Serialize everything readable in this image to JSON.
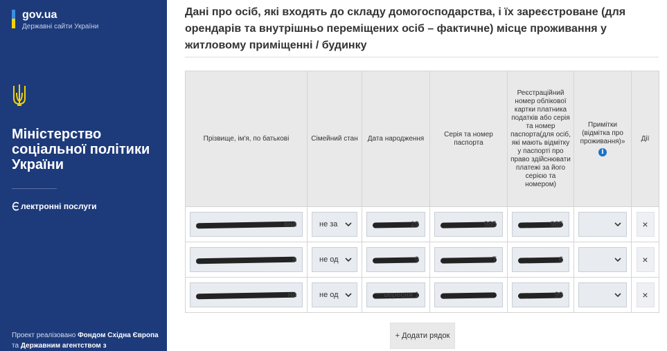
{
  "sidebar": {
    "brand_title": "gov.ua",
    "brand_subtitle": "Державні сайти України",
    "ministry_name": "Міністерство соціальної політики України",
    "eservices_label": "лектронні послуги",
    "footer_prefix": "Проект реалізовано ",
    "footer_link1": "Фондом Східна Європа",
    "footer_mid": " та ",
    "footer_link2": "Державним агентством з"
  },
  "colors": {
    "sidebar_bg": "#1d3a7a",
    "flag_blue": "#3b8fe0",
    "flag_yellow": "#f5d300",
    "info_icon": "#1a73c9"
  },
  "main": {
    "heading": "Дані про осіб, які входять до складу домогосподарства, і їх зареєстроване (для орендарів та внутрішньо переміщених осіб – фактичне) місце проживання у житловому приміщенні / будинку",
    "columns": [
      "Прізвище, ім'я, по батькові",
      "Сімейний стан",
      "Дата народження",
      "Серія та номер паспорта",
      "Реєстраційний номер облікової картки платника податків або серія та номер паспорта(для осіб, які мають відмітку у паспорті про право здійснювати платежі за його серією та номером)",
      "Примітки (відмітка про проживання)»",
      "Дії"
    ],
    "rows": [
      {
        "name_tail": "вна",
        "family_status": "не за",
        "birth_tail": "19",
        "passport_tail": "985",
        "tax_tail": "985",
        "note": "",
        "delete": "×"
      },
      {
        "name_tail": "а",
        "family_status": "не од",
        "birth_tail": "9",
        "passport_tail": "7",
        "tax_tail": "6",
        "note": "",
        "delete": "×"
      },
      {
        "name_tail": "на",
        "family_status": "не од",
        "birth_tail": "вересня 1",
        "passport_tail": "",
        "tax_tail": "99",
        "note": "",
        "delete": "×"
      }
    ],
    "add_row_label": "+ Додати рядок",
    "info_icon": "info-icon"
  }
}
